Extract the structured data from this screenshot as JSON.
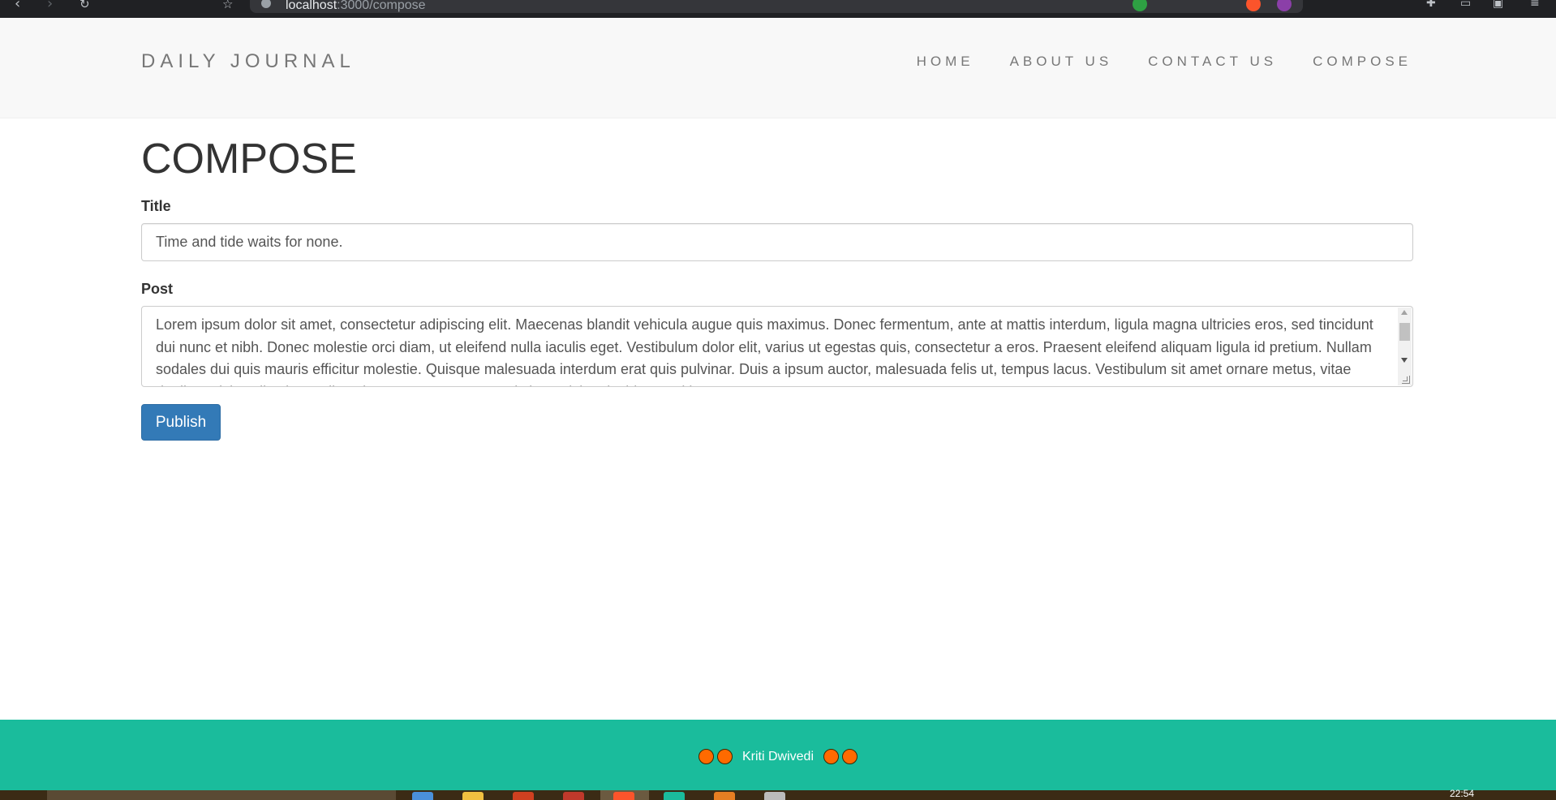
{
  "browser": {
    "url_host": "localhost",
    "url_rest": ":3000/compose"
  },
  "site": {
    "brand": "DAILY JOURNAL",
    "nav": [
      {
        "label": "HOME"
      },
      {
        "label": "ABOUT US"
      },
      {
        "label": "CONTACT US"
      },
      {
        "label": "COMPOSE"
      }
    ]
  },
  "compose": {
    "heading": "COMPOSE",
    "title_label": "Title",
    "title_value": "Time and tide waits for none.",
    "post_label": "Post",
    "post_value": "Lorem ipsum dolor sit amet, consectetur adipiscing elit. Maecenas blandit vehicula augue quis maximus. Donec fermentum, ante at mattis interdum, ligula magna ultricies eros, sed tincidunt dui nunc et nibh. Donec molestie orci diam, ut eleifend nulla iaculis eget. Vestibulum dolor elit, varius ut egestas quis, consectetur a eros. Praesent eleifend aliquam ligula id pretium. Nullam sodales dui quis mauris efficitur molestie. Quisque malesuada interdum erat quis pulvinar. Duis a ipsum auctor, malesuada felis ut, tempus lacus. Vestibulum sit amet ornare metus, vitae dapibus nisi. Nulla vitae velit, vel consequat metus, at tristique nisi et tincidunt sed lectus.",
    "publish_label": "Publish"
  },
  "footer": {
    "name": "Kriti Dwivedi"
  },
  "taskbar": {
    "clock": "22:54"
  },
  "colors": {
    "header_bg": "#f8f8f8",
    "footer_bg": "#1abc9c",
    "button_bg": "#337ab7",
    "dot": "#ff6a00"
  }
}
